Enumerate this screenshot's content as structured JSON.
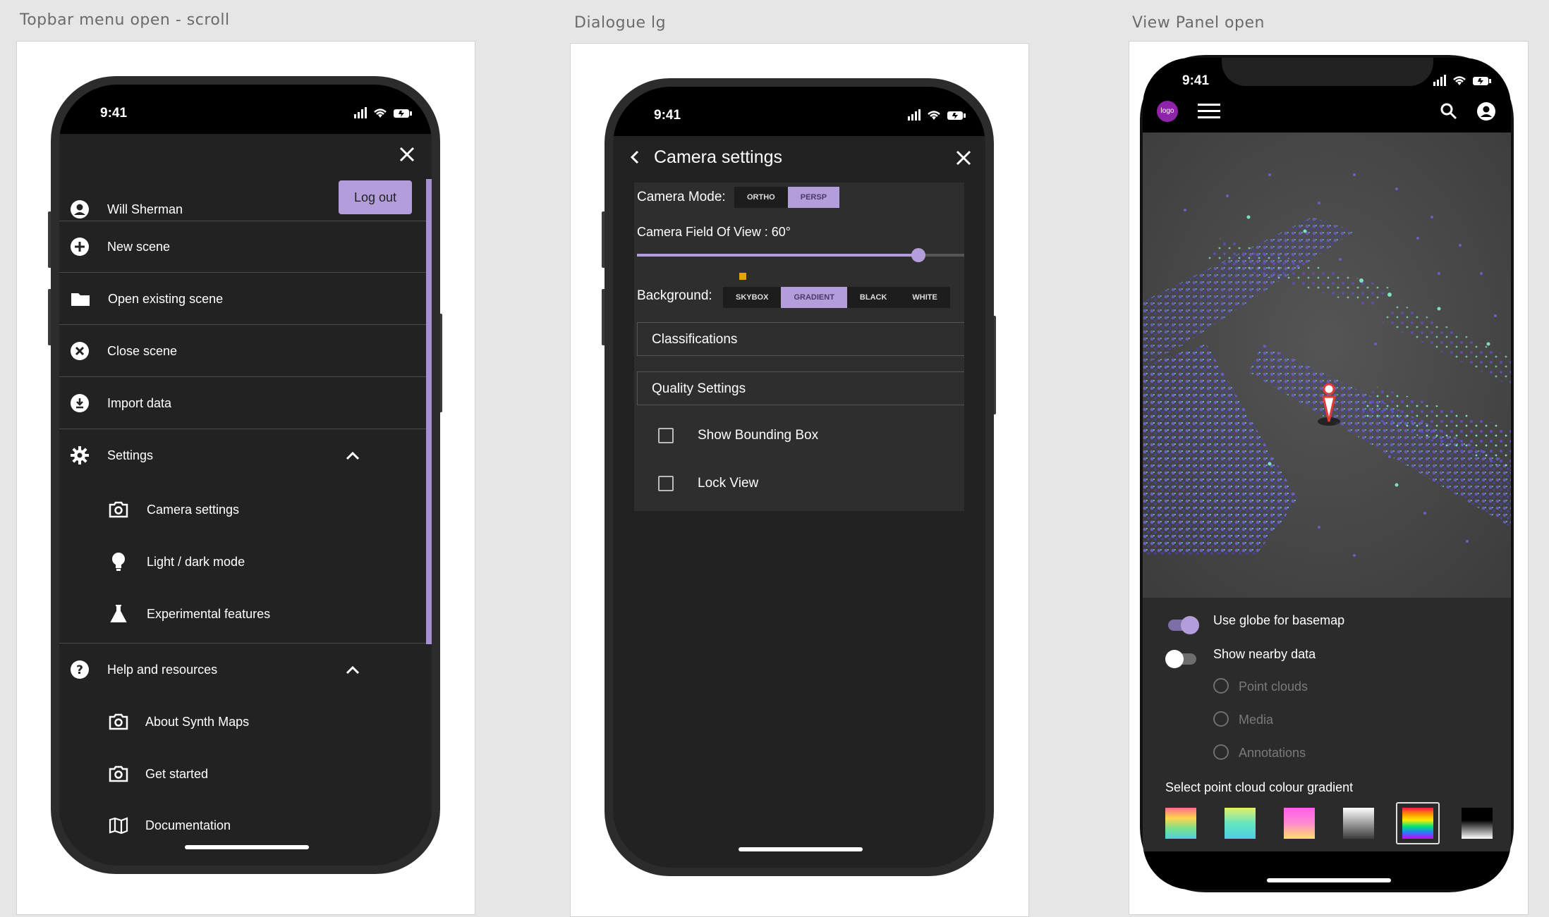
{
  "frames": [
    {
      "label": "Topbar menu open - scroll"
    },
    {
      "label": "Dialogue lg"
    },
    {
      "label": "View Panel open"
    }
  ],
  "status": {
    "time": "9:41"
  },
  "menu": {
    "user_name": "Will Sherman",
    "logout_label": "Log out",
    "items": [
      {
        "label": "New scene",
        "icon": "add-circle-icon"
      },
      {
        "label": "Open existing scene",
        "icon": "folder-icon"
      },
      {
        "label": "Close scene",
        "icon": "cancel-circle-icon"
      },
      {
        "label": "Import data",
        "icon": "download-circle-icon"
      }
    ],
    "settings": {
      "label": "Settings",
      "icon": "gear-icon",
      "sub": [
        {
          "label": "Camera settings",
          "icon": "camera-icon"
        },
        {
          "label": "Light / dark mode",
          "icon": "lightbulb-icon"
        },
        {
          "label": "Experimental features",
          "icon": "flask-icon"
        }
      ]
    },
    "help": {
      "label": "Help and resources",
      "icon": "help-icon",
      "sub": [
        {
          "label": "About Synth Maps",
          "icon": "camera-icon"
        },
        {
          "label": "Get started",
          "icon": "camera-icon"
        },
        {
          "label": "Documentation",
          "icon": "map-icon"
        }
      ]
    }
  },
  "dialog": {
    "title": "Camera settings",
    "camera_mode_label": "Camera Mode:",
    "camera_modes": [
      "ORTHO",
      "PERSP"
    ],
    "camera_mode_selected": "PERSP",
    "fov_label": "Camera Field Of View : 60°",
    "fov_fraction": 0.86,
    "background_label": "Background:",
    "backgrounds": [
      "SKYBOX",
      "GRADIENT",
      "BLACK",
      "WHITE"
    ],
    "background_selected": "GRADIENT",
    "sections": [
      "Classifications",
      "Quality Settings"
    ],
    "checkboxes": [
      {
        "label": "Show Bounding Box",
        "checked": false
      },
      {
        "label": "Lock View",
        "checked": false
      }
    ],
    "accent": "#b39ddb"
  },
  "view": {
    "logo": "logo",
    "toggles": [
      {
        "label": "Use globe for basemap",
        "on": true
      },
      {
        "label": "Show nearby data",
        "on": false
      }
    ],
    "radios": [
      "Point clouds",
      "Media",
      "Annotations"
    ],
    "gradient_label": "Select point cloud colour gradient",
    "gradients_selected_index": 4
  }
}
